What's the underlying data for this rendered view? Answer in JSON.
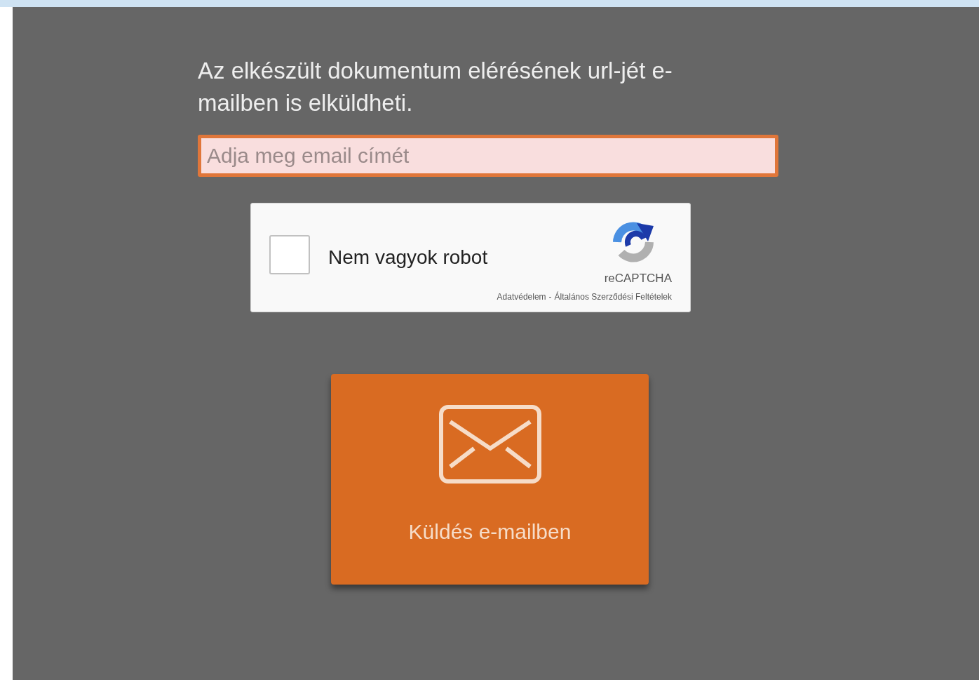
{
  "intro": "Az elkészült dokumentum elérésének url-jét e-mailben is elküldheti.",
  "email": {
    "placeholder": "Adja meg email címét",
    "invalid": true
  },
  "captcha": {
    "label": "Nem vagyok robot",
    "checked": false,
    "brand": "reCAPTCHA",
    "links": [
      "Adatvédelem",
      "Általános Szerződési Feltételek"
    ],
    "separator": "-"
  },
  "send_button": {
    "label": "Küldés e-mailben"
  }
}
